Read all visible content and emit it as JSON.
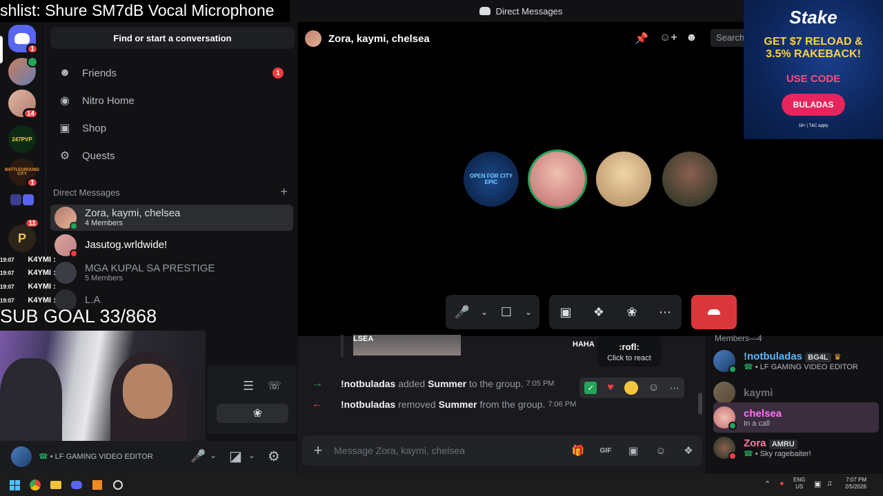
{
  "overlay": {
    "title": "shlist: Shure SM7dB Vocal Microphone",
    "sub_goal": "SUB GOAL 33/868",
    "chat_lines": [
      "K4YMI :",
      "K4YMI :",
      "K4YMI :",
      "K4YMI :"
    ],
    "chat_times": [
      "19:07",
      "19:07",
      "19:07",
      "19:07"
    ]
  },
  "topbar": {
    "title": "Direct Messages"
  },
  "servers": [
    {
      "badge": "1"
    },
    {
      "badge": ""
    },
    {
      "badge": "14"
    },
    {
      "label": "247PVP",
      "badge": ""
    },
    {
      "label": "BATTLEGROUND CITY",
      "badge": "1"
    },
    {
      "badge": ""
    },
    {
      "badge": "11"
    },
    {
      "label": "P",
      "badge": ""
    }
  ],
  "sidebar": {
    "search_label": "Find or start a conversation",
    "nav": [
      {
        "label": "Friends",
        "badge": "1"
      },
      {
        "label": "Nitro Home"
      },
      {
        "label": "Shop"
      },
      {
        "label": "Quests"
      }
    ],
    "dm_header": "Direct Messages",
    "add_icon": "+",
    "dms": [
      {
        "name": "Zora, kaymi, chelsea",
        "sub": "4 Members"
      },
      {
        "name": "Jasutog.wrldwide!",
        "sub": ""
      },
      {
        "name": "MGA KUPAL SA PRESTIGE",
        "sub": "5 Members"
      },
      {
        "name": "L.A",
        "sub": ""
      }
    ]
  },
  "user_panel": {
    "status": "LF GAMING VIDEO EDITOR",
    "partial_name": "BG4L"
  },
  "call": {
    "header": "Zora, kaymi, chelsea",
    "search_placeholder": "Search",
    "tile_text": "OPEN FOR CITY EPIC"
  },
  "chat": {
    "attachment_text": "LSEA",
    "attachment_text2": "HAHA",
    "tooltip_title": ":rofl:",
    "tooltip_sub": "Click to react",
    "messages": [
      {
        "actor": "!notbuladas",
        "verb": "added",
        "target": "Summer",
        "rest": "to the group.",
        "time": "7:05 PM"
      },
      {
        "actor": "!notbuladas",
        "verb": "removed",
        "target": "Summer",
        "rest": "from the group.",
        "time": "7:06 PM"
      }
    ],
    "input_placeholder": "Message Zora, kaymi, chelsea",
    "gif_label": "GIF"
  },
  "members": {
    "header": "Members—4",
    "list": [
      {
        "name": "!notbuladas",
        "tag": "BG4L",
        "sub": "LF GAMING VIDEO EDITOR",
        "color": "#5cb8ff"
      },
      {
        "name": "kaymi",
        "tag": "",
        "sub": "",
        "color": "#6d6f78"
      },
      {
        "name": "chelsea",
        "tag": "",
        "sub": "In a call",
        "color": "#ff73fa"
      },
      {
        "name": "Zora",
        "tag": "AMRU",
        "sub": "Sky ragebaiter!",
        "color": "#ff7aa0"
      }
    ]
  },
  "ad": {
    "brand": "Stake",
    "line1": "GET $7 RELOAD &",
    "line2": "3.5% RAKEBACK!",
    "use_code": "USE CODE",
    "code": "BULADAS",
    "fine": "18+ | T&C apply"
  },
  "taskbar": {
    "lang": "ENG",
    "region": "US",
    "time": "7:07 PM",
    "date": "2/5/2026"
  }
}
